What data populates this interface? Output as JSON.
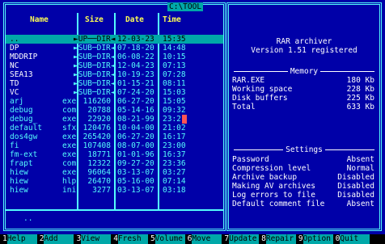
{
  "left_panel": {
    "path": "C:\\TOOL",
    "headers": {
      "name": "Name",
      "size": "Size",
      "date": "Date",
      "time": "Time"
    },
    "rows": [
      {
        "name": "..",
        "ext": "",
        "size": "►UP──DIR◄",
        "date": "12-03-23",
        "time": "15:35",
        "dir": true
      },
      {
        "name": "DP",
        "ext": "",
        "size": "►SUB─DIR◄",
        "date": "07-18-20",
        "time": "14:48",
        "dir": true
      },
      {
        "name": "MDDRIP",
        "ext": "",
        "size": "►SUB─DIR◄",
        "date": "06-08-22",
        "time": "10:15",
        "dir": true
      },
      {
        "name": "NC",
        "ext": "",
        "size": "►SUB─DIR◄",
        "date": "12-04-23",
        "time": "07:13",
        "dir": true
      },
      {
        "name": "SEA13",
        "ext": "",
        "size": "►SUB─DIR◄",
        "date": "10-19-23",
        "time": "07:28",
        "dir": true
      },
      {
        "name": "TD",
        "ext": "",
        "size": "►SUB─DIR◄",
        "date": "01-15-21",
        "time": "08:11",
        "dir": true
      },
      {
        "name": "VC",
        "ext": "",
        "size": "►SUB─DIR◄",
        "date": "07-24-20",
        "time": "15:03",
        "dir": true
      },
      {
        "name": "arj",
        "ext": "exe",
        "size": "116260",
        "date": "06-27-20",
        "time": "15:05"
      },
      {
        "name": "debug",
        "ext": "com",
        "size": "20788",
        "date": "05-14-16",
        "time": "09:32"
      },
      {
        "name": "debug_",
        "ext": "exe",
        "size": "22920",
        "date": "08-21-99",
        "time": "23:2"
      },
      {
        "name": "default",
        "ext": "sfx",
        "size": "120476",
        "date": "10-04-00",
        "time": "21:02"
      },
      {
        "name": "dos4gw",
        "ext": "exe",
        "size": "265420",
        "date": "06-27-20",
        "time": "16:17"
      },
      {
        "name": "fi",
        "ext": "exe",
        "size": "107408",
        "date": "08-07-00",
        "time": "23:00"
      },
      {
        "name": "fm-ext",
        "ext": "exe",
        "size": "18771",
        "date": "01-01-96",
        "time": "16:37"
      },
      {
        "name": "frapt",
        "ext": "com",
        "size": "12322",
        "date": "09-27-20",
        "time": "23:36"
      },
      {
        "name": "hiew",
        "ext": "exe",
        "size": "96064",
        "date": "03-13-07",
        "time": "03:27"
      },
      {
        "name": "hiew",
        "ext": "hlp",
        "size": "26470",
        "date": "05-16-00",
        "time": "07:14"
      },
      {
        "name": "hiew",
        "ext": "ini",
        "size": "3277",
        "date": "03-13-07",
        "time": "03:18"
      }
    ],
    "status": ".."
  },
  "right_panel": {
    "title": "RAR archiver",
    "version": "Version 1.51 registered",
    "memory_header": "Memory",
    "memory": [
      {
        "key": "RAR.EXE",
        "value": "180 Kb"
      },
      {
        "key": "Working space",
        "value": "228 Kb"
      },
      {
        "key": "Disk buffers",
        "value": "225 Kb"
      },
      {
        "key": "Total",
        "value": "633 Kb"
      }
    ],
    "settings_header": "Settings",
    "settings": [
      {
        "key": "Password",
        "value": "Absent"
      },
      {
        "key": "Compression level",
        "value": "Normal"
      },
      {
        "key": "Archive backup",
        "value": "Disabled"
      },
      {
        "key": "Making AV archives",
        "value": "Disabled"
      },
      {
        "key": "Log errors to file",
        "value": "Disabled"
      },
      {
        "key": "Default comment file",
        "value": "Absent"
      }
    ]
  },
  "keybar": [
    {
      "num": "1",
      "label": "Help"
    },
    {
      "num": "2",
      "label": "Add"
    },
    {
      "num": "3",
      "label": "View"
    },
    {
      "num": "4",
      "label": "Fresh"
    },
    {
      "num": "5",
      "label": "Volume"
    },
    {
      "num": "6",
      "label": "Move"
    },
    {
      "num": "7",
      "label": "Update"
    },
    {
      "num": "8",
      "label": "Repair"
    },
    {
      "num": "9",
      "label": "Option"
    },
    {
      "num": "0",
      "label": "Quit"
    }
  ],
  "colors": {
    "background": "#0000a8",
    "frame": "#54fcfc",
    "header": "#fcfc54",
    "selection": "#00a8a8"
  }
}
